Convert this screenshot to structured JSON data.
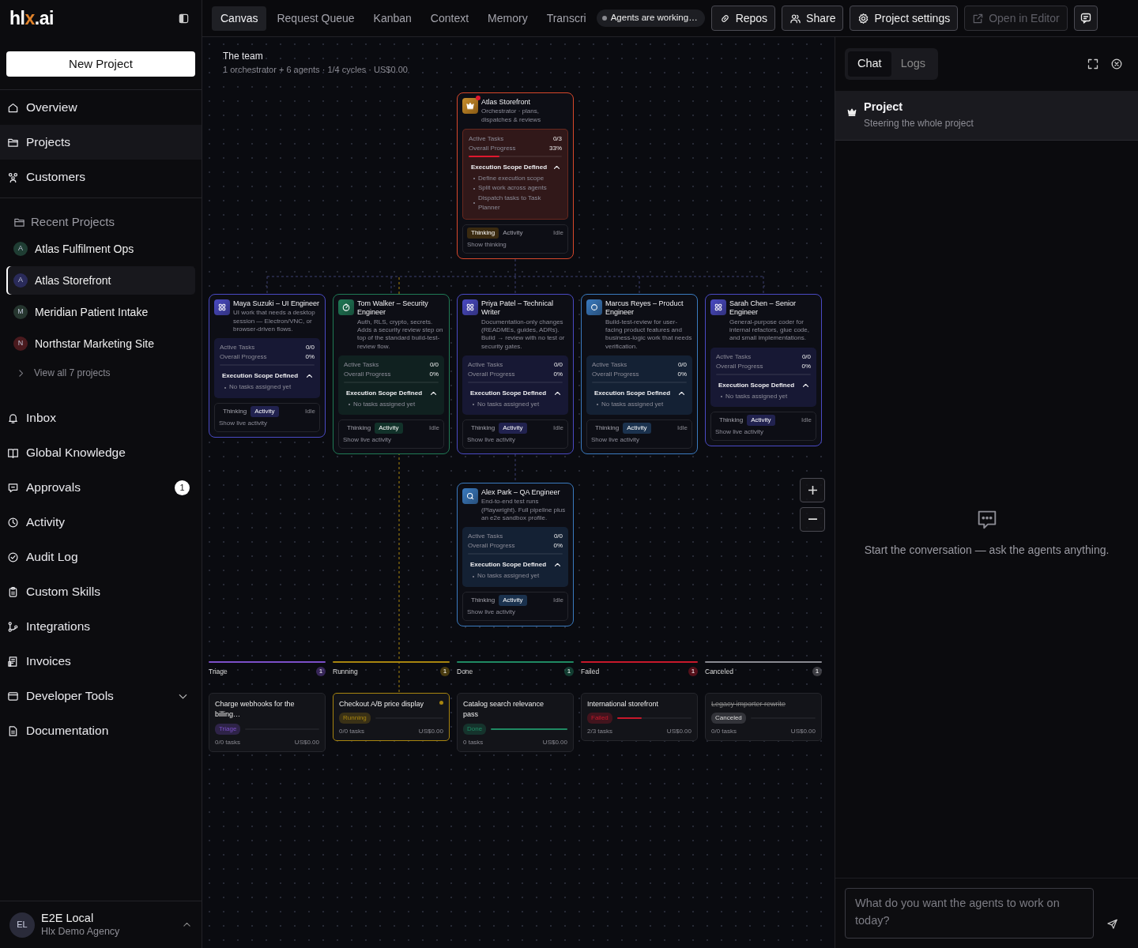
{
  "sidebar": {
    "logo_parts": [
      "hl",
      "x",
      ".ai"
    ],
    "new_project_button": "New Project",
    "nav": [
      {
        "label": "Overview",
        "selected": false
      },
      {
        "label": "Projects",
        "selected": true
      },
      {
        "label": "Customers",
        "selected": false
      }
    ],
    "recent_projects": {
      "heading": "Recent Projects",
      "items": [
        {
          "initial": "A",
          "name": "Atlas Fulfilment Ops",
          "color": "#1f3d33",
          "selected": false
        },
        {
          "initial": "A",
          "name": "Atlas Storefront",
          "color": "#2a2b5a",
          "selected": true
        },
        {
          "initial": "M",
          "name": "Meridian Patient Intake",
          "color": "#26362f",
          "selected": false
        },
        {
          "initial": "N",
          "name": "Northstar Marketing Site",
          "color": "#4a1a1e",
          "selected": false
        }
      ],
      "view_all": "View all 7 projects"
    },
    "nav_secondary": [
      {
        "label": "Inbox",
        "kind": "link"
      },
      {
        "label": "Global Knowledge",
        "kind": "link"
      },
      {
        "label": "Approvals",
        "kind": "link",
        "badge": "1"
      },
      {
        "label": "Activity",
        "kind": "link"
      },
      {
        "label": "Audit Log",
        "kind": "link"
      },
      {
        "label": "Custom Skills",
        "kind": "link"
      },
      {
        "label": "Integrations",
        "kind": "link"
      },
      {
        "label": "Invoices",
        "kind": "link"
      },
      {
        "label": "Developer Tools",
        "kind": "group",
        "expanded": false
      },
      {
        "label": "Documentation",
        "kind": "link"
      }
    ],
    "user": {
      "initials": "EL",
      "name": "E2E Local",
      "org": "Hlx Demo Agency"
    }
  },
  "topbar": {
    "tabs": [
      {
        "label": "Canvas",
        "selected": true
      },
      {
        "label": "Request Queue",
        "selected": false
      },
      {
        "label": "Kanban",
        "selected": false
      },
      {
        "label": "Context",
        "selected": false
      },
      {
        "label": "Memory",
        "selected": false
      },
      {
        "label": "Transcri",
        "selected": false
      }
    ],
    "status_pill": "Agents are working…",
    "buttons": [
      {
        "label": "Repos",
        "disabled": false
      },
      {
        "label": "Share",
        "disabled": false
      },
      {
        "label": "Project settings",
        "disabled": false
      },
      {
        "label": "Open in Editor",
        "disabled": true
      }
    ]
  },
  "canvas": {
    "title": "The team",
    "summary": "1 orchestrator + 6 agents · 1/4 cycles · US$0.00",
    "nodes": [
      {
        "kind": "orchestrator",
        "name": "Atlas Storefront",
        "description": "Orchestrator · plans, dispatches & reviews",
        "color": "#d9482b",
        "notification": true,
        "stats": [
          {
            "label": "Active Tasks",
            "value": "0/3"
          },
          {
            "label": "Overall Progress",
            "value": "33%"
          }
        ],
        "level": 0.33,
        "scope": {
          "title": "Execution Scope Defined",
          "items": [
            "Define execution scope",
            "Split work across agents",
            "Dispatch tasks to Task Planner"
          ]
        },
        "tabs": [
          {
            "label": "Thinking",
            "selected": true
          },
          {
            "label": "Activity",
            "selected": false
          }
        ],
        "status": "Idle",
        "footer": "Show thinking"
      },
      {
        "kind": "agent",
        "name": "Maya Suzuki – UI Engineer",
        "description": "UI work that needs a desktop session — Electron/VNC, or browser-driven flows.",
        "color": "#4a4ac4",
        "notification": false,
        "stats": [
          {
            "label": "Active Tasks",
            "value": "0/0"
          },
          {
            "label": "Overall Progress",
            "value": "0%"
          }
        ],
        "level": 0,
        "scope": {
          "title": "Execution Scope Defined",
          "items": [
            "No tasks assigned yet"
          ]
        },
        "tabs": [
          {
            "label": "Thinking",
            "selected": false
          },
          {
            "label": "Activity",
            "selected": true
          }
        ],
        "status": "Idle",
        "footer": "Show live activity"
      },
      {
        "kind": "agent",
        "name": "Tom Walker – Security Engineer",
        "description": "Auth, RLS, crypto, secrets. Adds a security review step on top of the standard build-test-review flow.",
        "color": "#1f7a55",
        "notification": false,
        "stats": [
          {
            "label": "Active Tasks",
            "value": "0/0"
          },
          {
            "label": "Overall Progress",
            "value": "0%"
          }
        ],
        "level": 0,
        "scope": {
          "title": "Execution Scope Defined",
          "items": [
            "No tasks assigned yet"
          ]
        },
        "tabs": [
          {
            "label": "Thinking",
            "selected": false
          },
          {
            "label": "Activity",
            "selected": true
          }
        ],
        "status": "Idle",
        "footer": "Show live activity"
      },
      {
        "kind": "agent",
        "name": "Priya Patel – Technical Writer",
        "description": "Documentation-only changes (READMEs, guides, ADRs). Build → review with no test or security gates.",
        "color": "#4a4ac4",
        "notification": false,
        "stats": [
          {
            "label": "Active Tasks",
            "value": "0/0"
          },
          {
            "label": "Overall Progress",
            "value": "0%"
          }
        ],
        "level": 0,
        "scope": {
          "title": "Execution Scope Defined",
          "items": [
            "No tasks assigned yet"
          ]
        },
        "tabs": [
          {
            "label": "Thinking",
            "selected": false
          },
          {
            "label": "Activity",
            "selected": true
          }
        ],
        "status": "Idle",
        "footer": "Show live activity"
      },
      {
        "kind": "agent",
        "name": "Marcus Reyes – Product Engineer",
        "description": "Build-test-review for user-facing product features and business-logic work that needs verification.",
        "color": "#3a7bc0",
        "notification": false,
        "stats": [
          {
            "label": "Active Tasks",
            "value": "0/0"
          },
          {
            "label": "Overall Progress",
            "value": "0%"
          }
        ],
        "level": 0,
        "scope": {
          "title": "Execution Scope Defined",
          "items": [
            "No tasks assigned yet"
          ]
        },
        "tabs": [
          {
            "label": "Thinking",
            "selected": false
          },
          {
            "label": "Activity",
            "selected": true
          }
        ],
        "status": "Idle",
        "footer": "Show live activity"
      },
      {
        "kind": "agent",
        "name": "Sarah Chen – Senior Engineer",
        "description": "General-purpose coder for internal refactors, glue code, and small implementations.",
        "color": "#4a4ac4",
        "notification": false,
        "stats": [
          {
            "label": "Active Tasks",
            "value": "0/0"
          },
          {
            "label": "Overall Progress",
            "value": "0%"
          }
        ],
        "level": 0,
        "scope": {
          "title": "Execution Scope Defined",
          "items": [
            "No tasks assigned yet"
          ]
        },
        "tabs": [
          {
            "label": "Thinking",
            "selected": false
          },
          {
            "label": "Activity",
            "selected": true
          }
        ],
        "status": "Idle",
        "footer": "Show live activity"
      },
      {
        "kind": "agent",
        "name": "Alex Park – QA Engineer",
        "description": "End-to-end test runs (Playwright). Full pipeline plus an e2e sandbox profile.",
        "color": "#3a7bc0",
        "notification": false,
        "stats": [
          {
            "label": "Active Tasks",
            "value": "0/0"
          },
          {
            "label": "Overall Progress",
            "value": "0%"
          }
        ],
        "level": 0,
        "scope": {
          "title": "Execution Scope Defined",
          "items": [
            "No tasks assigned yet"
          ]
        },
        "tabs": [
          {
            "label": "Thinking",
            "selected": false
          },
          {
            "label": "Activity",
            "selected": true
          }
        ],
        "status": "Idle",
        "footer": "Show live activity"
      }
    ],
    "kanban": [
      {
        "column": "Triage",
        "count": "1",
        "color": "#7b4fc9",
        "card": {
          "title": "Charge webhooks for the billing…",
          "status": "Triage",
          "level": 0,
          "tasks": "0/0 tasks",
          "cost": "US$0.00",
          "selected": false,
          "struck": false
        }
      },
      {
        "column": "Running",
        "count": "1",
        "color": "#a8850f",
        "card": {
          "title": "Checkout A/B price display",
          "status": "Running",
          "level": 0,
          "tasks": "0/0 tasks",
          "cost": "US$0.00",
          "selected": true,
          "struck": false
        }
      },
      {
        "column": "Done",
        "count": "1",
        "color": "#1f8a63",
        "card": {
          "title": "Catalog search relevance pass",
          "status": "Done",
          "level": 1,
          "tasks": "0 tasks",
          "cost": "US$0.00",
          "selected": false,
          "struck": false
        }
      },
      {
        "column": "Failed",
        "count": "1",
        "color": "#c8182b",
        "card": {
          "title": "International storefront",
          "status": "Failed",
          "level": 0.33,
          "tasks": "2/3 tasks",
          "cost": "US$0.00",
          "selected": false,
          "struck": false
        }
      },
      {
        "column": "Canceled",
        "count": "1",
        "color": "#8a8a92",
        "card": {
          "title": "Legacy importer rewrite",
          "status": "Canceled",
          "level": 0,
          "tasks": "0/0 tasks",
          "cost": "US$0.00",
          "selected": false,
          "struck": true
        }
      }
    ]
  },
  "chat_panel": {
    "tabs": [
      {
        "label": "Chat",
        "selected": true
      },
      {
        "label": "Logs",
        "selected": false
      }
    ],
    "thread": {
      "title": "Project",
      "subtitle": "Steering the whole project"
    },
    "empty_message": "Start the conversation — ask the agents anything.",
    "input": {
      "placeholder": "What do you want the agents to work on today?"
    }
  }
}
